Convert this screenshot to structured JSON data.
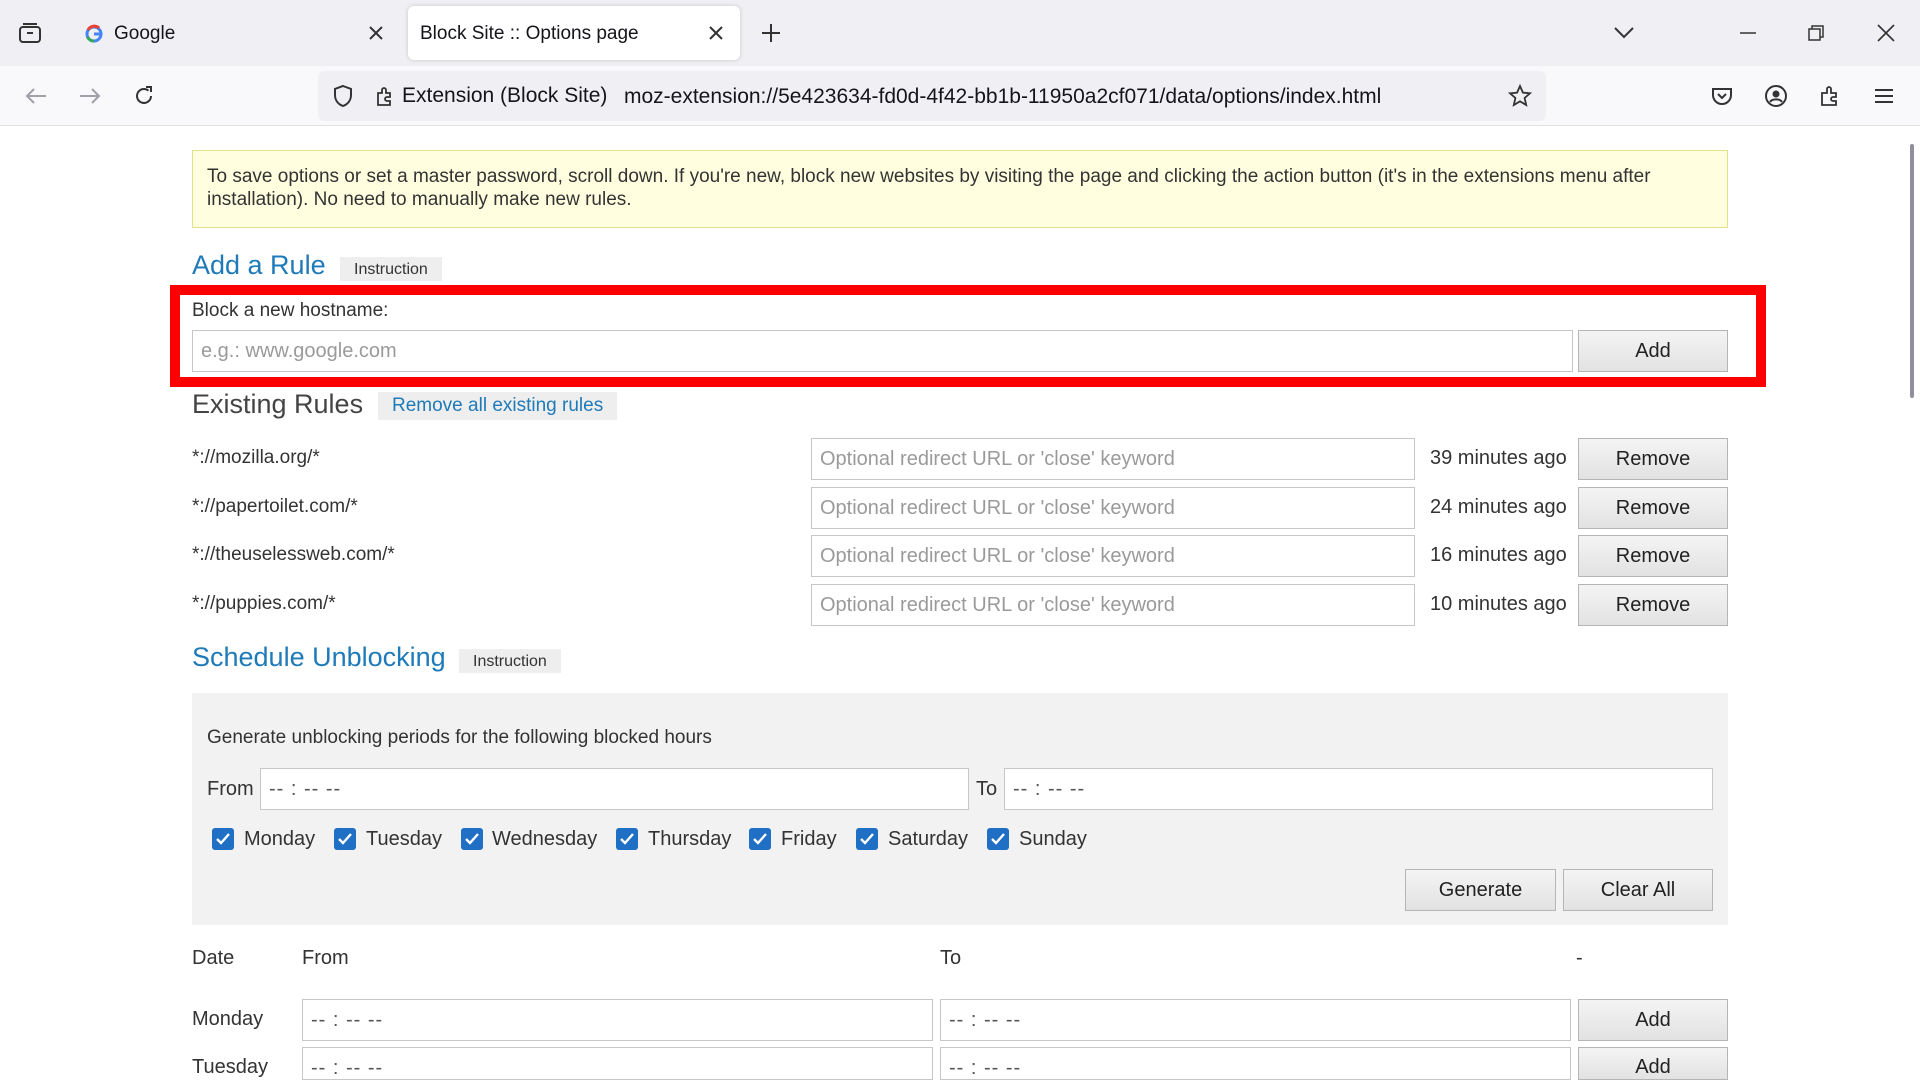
{
  "browser": {
    "tabs": [
      {
        "title": "Google"
      },
      {
        "title": "Block Site :: Options page"
      }
    ],
    "url_chip": "Extension (Block Site)",
    "url": "moz-extension://5e423634-fd0d-4f42-bb1b-11950a2cf071/data/options/index.html"
  },
  "notice": "To save options or set a master password, scroll down. If you're new, block new websites by visiting the page and clicking the action button (it's in the extensions menu after installation). No need to manually make new rules.",
  "add_rule": {
    "heading": "Add a Rule",
    "instruction": "Instruction",
    "label": "Block a new hostname:",
    "placeholder": "e.g.: www.google.com",
    "add_label": "Add"
  },
  "existing_rules": {
    "heading": "Existing Rules",
    "remove_all": "Remove all existing rules",
    "redirect_placeholder": "Optional redirect URL or 'close' keyword",
    "remove_label": "Remove",
    "rules": [
      {
        "host": "*://mozilla.org/*",
        "age": "39 minutes ago"
      },
      {
        "host": "*://papertoilet.com/*",
        "age": "24 minutes ago"
      },
      {
        "host": "*://theuselessweb.com/*",
        "age": "16 minutes ago"
      },
      {
        "host": "*://puppies.com/*",
        "age": "10 minutes ago"
      }
    ]
  },
  "schedule": {
    "heading": "Schedule Unblocking",
    "instruction": "Instruction",
    "description": "Generate unblocking periods for the following blocked hours",
    "from_label": "From",
    "to_label": "To",
    "time_placeholder": "-- : --   --",
    "days": [
      {
        "label": "Monday",
        "checked": true
      },
      {
        "label": "Tuesday",
        "checked": true
      },
      {
        "label": "Wednesday",
        "checked": true
      },
      {
        "label": "Thursday",
        "checked": true
      },
      {
        "label": "Friday",
        "checked": true
      },
      {
        "label": "Saturday",
        "checked": true
      },
      {
        "label": "Sunday",
        "checked": true
      }
    ],
    "generate_label": "Generate",
    "clear_label": "Clear All"
  },
  "periods": {
    "headers": {
      "date": "Date",
      "from": "From",
      "to": "To",
      "dash": "-"
    },
    "add_label": "Add",
    "rows": [
      {
        "day": "Monday"
      },
      {
        "day": "Tuesday"
      }
    ]
  },
  "colors": {
    "accent": "#1e7ab8",
    "highlight": "#ff0000",
    "notice_bg": "#ffffe0",
    "checkbox": "#1f6fc5"
  }
}
